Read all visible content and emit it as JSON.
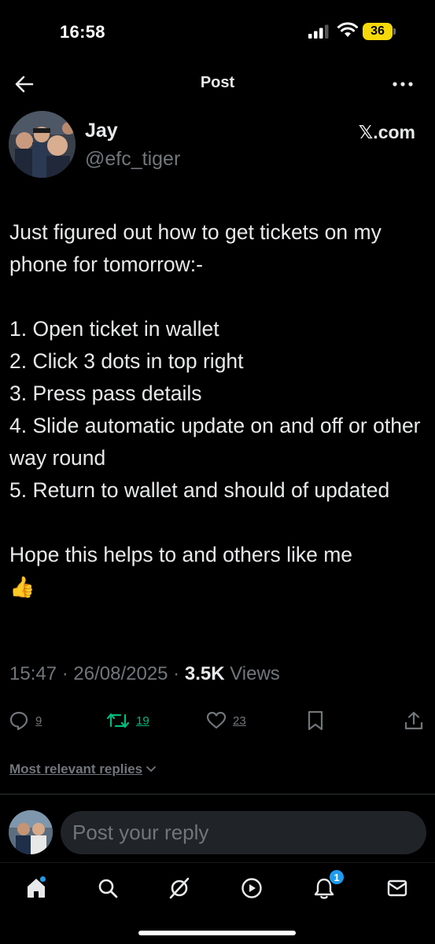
{
  "status_bar": {
    "time": "16:58",
    "battery": "36"
  },
  "header": {
    "title": "Post"
  },
  "author": {
    "name": "Jay",
    "handle": "@efc_tiger",
    "source": "𝕏.com"
  },
  "tweet": {
    "intro": "Just figured out how to get tickets on my phone for tomorrow:-",
    "steps": [
      "1. Open ticket in wallet",
      "2. Click 3 dots in top right",
      "3. Press pass details",
      "4. Slide automatic update on and off or other way round",
      "5. Return to wallet and should of updated"
    ],
    "outro": "Hope this helps to and others like me",
    "emoji": "👍"
  },
  "meta": {
    "time": "15:47",
    "date": "26/08/2025",
    "views_count": "3.5K",
    "views_label": "Views",
    "sep": " · "
  },
  "actions": {
    "replies": "9",
    "reposts": "19",
    "likes": "23"
  },
  "replies_filter": {
    "label": "Most relevant replies"
  },
  "reply_box": {
    "placeholder": "Post your reply"
  },
  "nav": {
    "notifications_badge": "1"
  },
  "colors": {
    "accent": "#1d9bf0",
    "repost": "#00ba7c",
    "muted": "#71767b",
    "battery": "#f5d90a"
  }
}
